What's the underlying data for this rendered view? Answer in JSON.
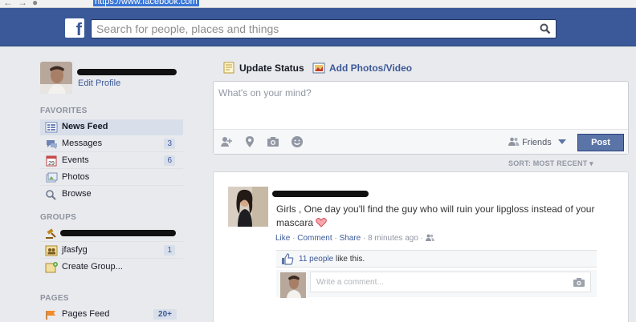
{
  "browser": {
    "url": "https://www.facebook.com"
  },
  "header": {
    "logo_letter": "f",
    "search_placeholder": "Search for people, places and things"
  },
  "profile": {
    "edit_label": "Edit Profile"
  },
  "sidebar": {
    "favorites_title": "FAVORITES",
    "favorites": [
      {
        "label": "News Feed",
        "count": "",
        "icon": "news-feed-icon"
      },
      {
        "label": "Messages",
        "count": "3",
        "icon": "messages-icon"
      },
      {
        "label": "Events",
        "count": "6",
        "icon": "events-icon"
      },
      {
        "label": "Photos",
        "count": "",
        "icon": "photos-icon"
      },
      {
        "label": "Browse",
        "count": "",
        "icon": "browse-icon"
      }
    ],
    "groups_title": "GROUPS",
    "groups": [
      {
        "label": "",
        "count": "",
        "icon": "group-gavel-icon"
      },
      {
        "label": "jfasfyg",
        "count": "1",
        "icon": "group-icon"
      },
      {
        "label": "Create Group...",
        "count": "",
        "icon": "create-group-icon"
      }
    ],
    "pages_title": "PAGES",
    "pages": [
      {
        "label": "Pages Feed",
        "count": "20+",
        "icon": "pages-feed-icon"
      }
    ]
  },
  "composer": {
    "tab_status": "Update Status",
    "tab_photo": "Add Photos/Video",
    "placeholder": "What's on your mind?",
    "audience": "Friends",
    "post_label": "Post"
  },
  "feed": {
    "sort_label": "SORT: MOST RECENT"
  },
  "story": {
    "text": "Girls , One day you'll find the guy who will ruin your lipgloss instead of your mascara",
    "like": "Like",
    "comment": "Comment",
    "share": "Share",
    "time": "8 minutes ago",
    "likes_link": "11 people",
    "likes_rest": " like this.",
    "comment_placeholder": "Write a comment..."
  }
}
